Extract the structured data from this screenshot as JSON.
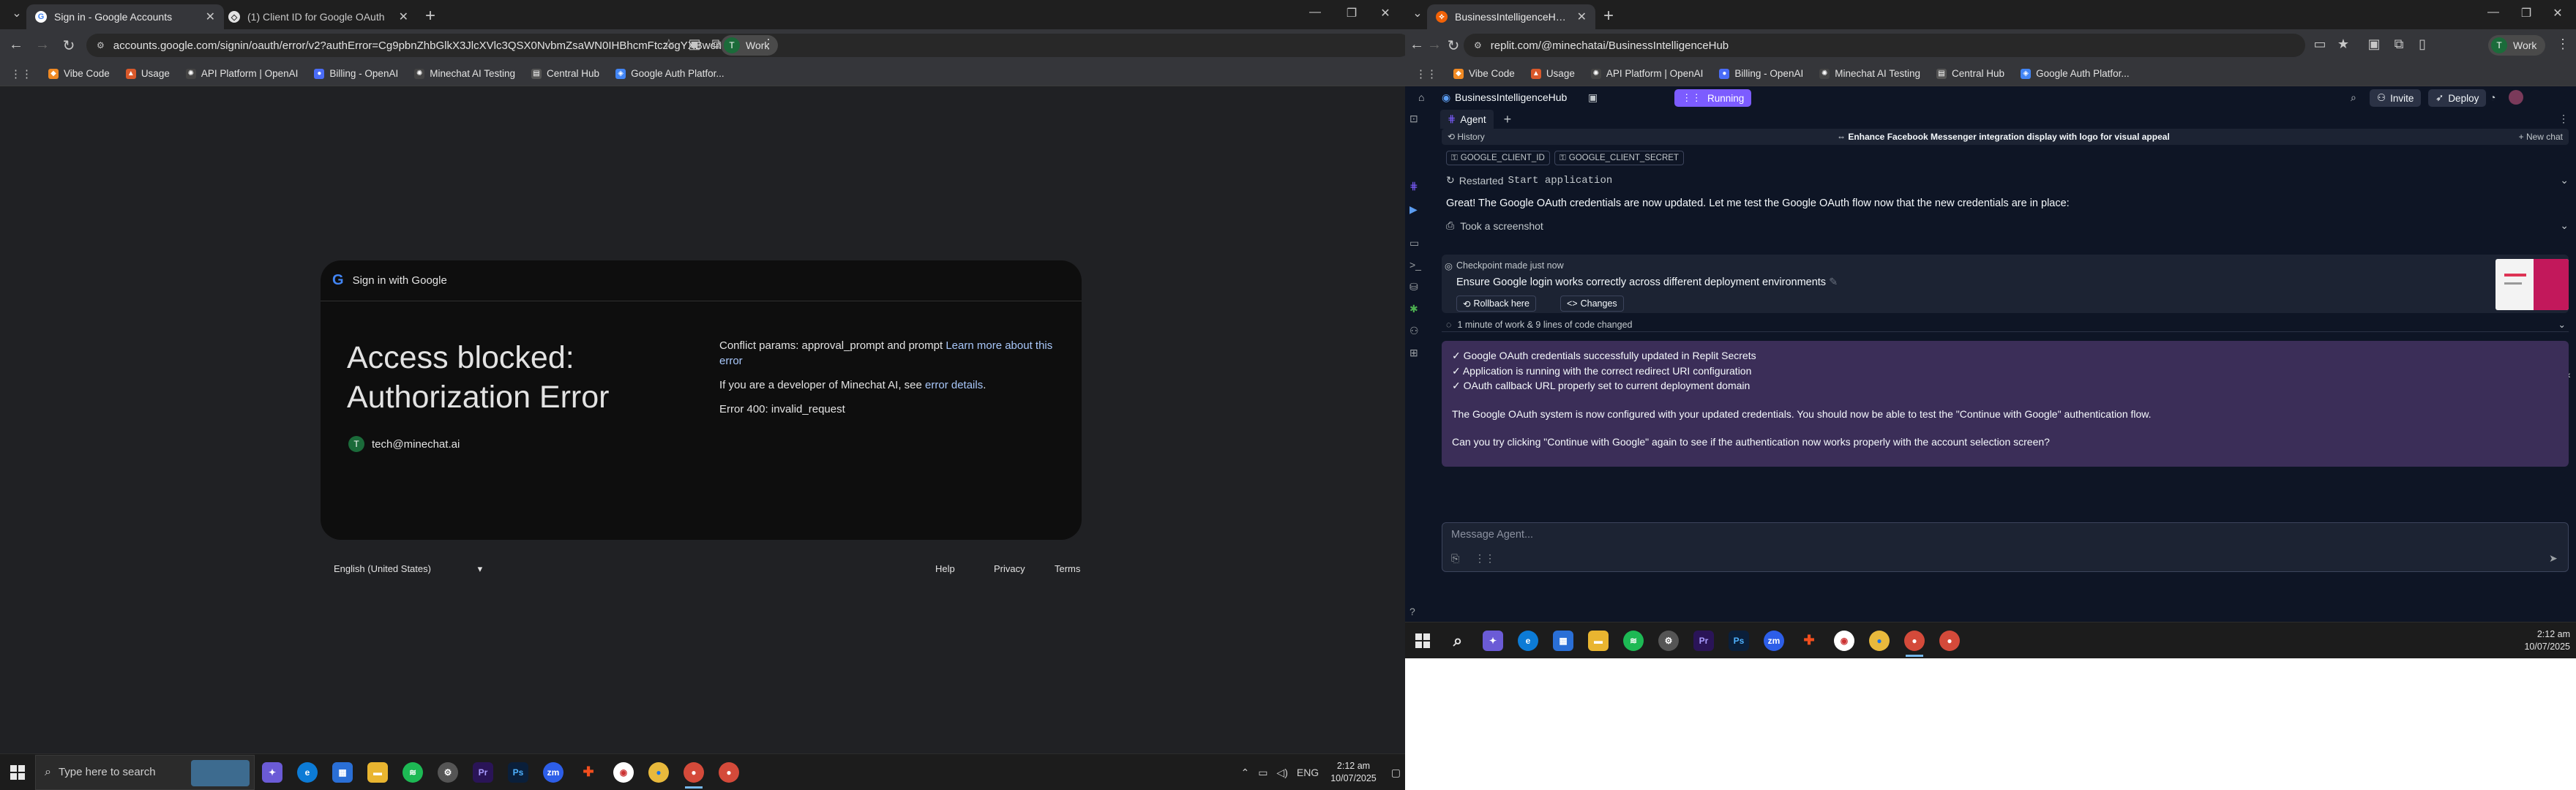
{
  "left_browser": {
    "tabs": [
      {
        "title": "Sign in - Google Accounts",
        "icon": "google-g-icon",
        "active": true
      },
      {
        "title": "(1) Client ID for Google OAuth",
        "icon": "developer-icon",
        "active": false
      }
    ],
    "url": "accounts.google.com/signin/oauth/error/v2?authError=Cg9pbnZhbGlkX3JlcXVlc3QSX0NvbmZsaWN0IHBhcmFtczogYXBwcm92YWxfcHJvbXB0IGFuZCBwcm9tcHQKN2h0dHBzOi8vZGV2ZWxvcGVycy5nb29nbGUuY29tL2lkZW50aXR5L3Byb3RvY29...",
    "profile": {
      "initial": "T",
      "label": "Work"
    },
    "bookmarks": [
      "Vibe Code",
      "Usage",
      "API Platform | OpenAI",
      "Billing - OpenAI",
      "Minechat AI Testing",
      "Central Hub",
      "Google Auth Platfor..."
    ]
  },
  "google_page": {
    "header": "Sign in with Google",
    "title": "Access blocked: Authorization Error",
    "account": {
      "initial": "T",
      "email": "tech@minechat.ai"
    },
    "conflict_text": "Conflict params: approval_prompt and prompt",
    "learn_more": "Learn more about this error",
    "developer_text": "If you are a developer of Minechat AI, see",
    "error_details": "error details",
    "error_code": "Error 400: invalid_request",
    "language": "English (United States)",
    "footer_links": [
      "Help",
      "Privacy",
      "Terms"
    ]
  },
  "taskbar_left": {
    "search_placeholder": "Type here to search",
    "language": "ENG",
    "time": "2:12 am",
    "date": "10/07/2025"
  },
  "right_browser": {
    "tabs": [
      {
        "title": "BusinessIntelligenceHub - Repli",
        "icon": "replit-icon",
        "active": true
      }
    ],
    "url": "replit.com/@minechatai/BusinessIntelligenceHub",
    "profile": {
      "initial": "T",
      "label": "Work"
    },
    "bookmarks": [
      "Vibe Code",
      "Usage",
      "API Platform | OpenAI",
      "Billing - OpenAI",
      "Minechat AI Testing",
      "Central Hub",
      "Google Auth Platfor..."
    ]
  },
  "replit": {
    "project": "BusinessIntelligenceHub",
    "run_label": "Running",
    "invite_label": "Invite",
    "deploy_label": "Deploy",
    "tab": "Agent",
    "history_label": "History",
    "thread_title": "Enhance Facebook Messenger integration display with logo for visual appeal",
    "new_chat": "New chat",
    "secrets": [
      "GOOGLE_CLIENT_ID",
      "GOOGLE_CLIENT_SECRET"
    ],
    "restarted": "Restarted",
    "restarted_target": "Start application",
    "message1": "Great! The Google OAuth credentials are now updated. Let me test the Google OAuth flow now that the new credentials are in place:",
    "screenshot_label": "Took a screenshot",
    "checkpoint": {
      "header": "Checkpoint made just now",
      "title": "Ensure Google login works correctly across different deployment environments",
      "rollback": "Rollback here",
      "changes": "Changes"
    },
    "work_summary": "1 minute of work & 9 lines of code changed",
    "summary_lines": [
      "✓ Google OAuth credentials successfully updated in Replit Secrets",
      "✓ Application is running with the correct redirect URI configuration",
      "✓ OAuth callback URL properly set to current deployment domain"
    ],
    "summary_paragraph": "The Google OAuth system is now configured with your updated credentials. You should now be able to test the \"Continue with Google\" authentication flow.",
    "summary_question": "Can you try clicking \"Continue with Google\" again to see if the authentication now works properly with the account selection screen?",
    "input_placeholder": "Message Agent..."
  },
  "taskbar_right": {
    "time": "2:12 am",
    "date": "10/07/2025"
  }
}
